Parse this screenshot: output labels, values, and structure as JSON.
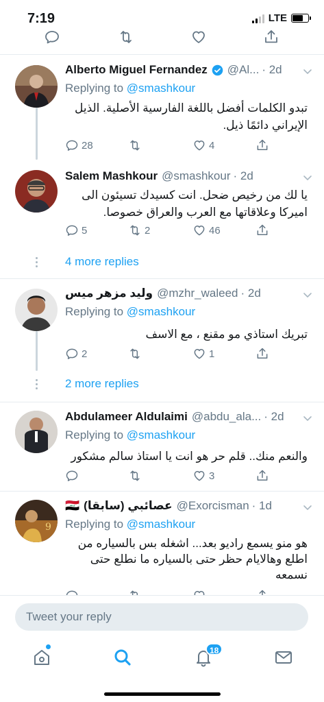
{
  "status_bar": {
    "time": "7:19",
    "network": "LTE"
  },
  "colors": {
    "accent": "#1da1f2",
    "secondary_text": "#657786",
    "divider": "#e6ecf0"
  },
  "tweets": [
    {
      "name": "Alberto Miguel Fernandez",
      "verified": true,
      "handle": "@Al...",
      "time": "· 2d",
      "replying_prefix": "Replying to ",
      "replying_to": "@smashkour",
      "text": "تبدو الكلمات أفضل باللغة الفارسية الأصلية. الذيل الإيراني دائمًا ذيل.",
      "reply_count": "28",
      "retweet_count": "",
      "like_count": "4"
    },
    {
      "name": "Salem Mashkour",
      "handle": "@smashkour",
      "time": "· 2d",
      "text": "يا لك من رخيص ضحل. انت كسيدك تسيئون الى اميركا وعلاقاتها مع العرب والعراق خصوصا.",
      "reply_count": "5",
      "retweet_count": "2",
      "like_count": "46",
      "more_replies": "4 more replies"
    },
    {
      "name": "وليد مزهر ميس",
      "handle": "@mzhr_waleed",
      "time": "· 2d",
      "replying_prefix": "Replying to ",
      "replying_to": "@smashkour",
      "text": "تبريك استاذي مو مقنع ، مع الاسف",
      "reply_count": "2",
      "retweet_count": "",
      "like_count": "1",
      "more_replies": "2 more replies"
    },
    {
      "name": "Abdulameer Aldulaimi",
      "handle": "@abdu_ala...",
      "time": "· 2d",
      "replying_prefix": "Replying to ",
      "replying_to": "@smashkour",
      "text": "والنعم منك.. قلم حر هو انت يا استاذ سالم مشكور",
      "reply_count": "",
      "retweet_count": "",
      "like_count": "3"
    },
    {
      "name": "عصائبي (سابقا)",
      "flag": "🇮🇶",
      "handle": "@Exorcisman",
      "time": "· 1d",
      "replying_prefix": "Replying to ",
      "replying_to": "@smashkour",
      "text": "هو منو يسمع راديو بعد... اشغله بس بالسياره من اطلع وهالايام حظر حتى بالسياره ما نطلع حتى نسمعه"
    }
  ],
  "compose": {
    "placeholder": "Tweet your reply"
  },
  "tabbar": {
    "notifications_badge": "18"
  },
  "icons": {
    "reply": "reply-icon",
    "retweet": "retweet-icon",
    "like": "heart-icon",
    "share": "share-icon",
    "chevron": "chevron-down-icon",
    "verified": "verified-badge-icon",
    "home": "home-icon",
    "search": "search-icon",
    "notifications": "bell-icon",
    "messages": "mail-icon"
  }
}
